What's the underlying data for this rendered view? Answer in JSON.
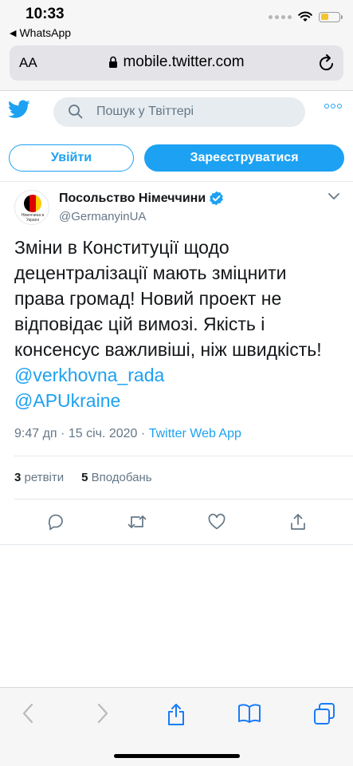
{
  "status_bar": {
    "time": "10:33",
    "back_app": "WhatsApp"
  },
  "browser": {
    "text_size_label": "AA",
    "url": "mobile.twitter.com"
  },
  "header": {
    "search_placeholder": "Пошук у Твіттері"
  },
  "auth": {
    "login_label": "Увійти",
    "signup_label": "Зареєструватися"
  },
  "tweet": {
    "author_name": "Посольство Німеччини",
    "handle": "@GermanyinUA",
    "avatar_caption": "Німеччина в Україні",
    "text": "Зміни в Конституції щодо децентралізації мають зміцнити права громад! Новий проект не відповідає цій вимозі. Якість і консенсус важливіші, ніж швидкість! ",
    "mention_1": "@verkhovna_rada",
    "mention_2": "@APUkraine",
    "time": "9:47 дп",
    "separator": "·",
    "date": "15 січ. 2020",
    "source": "Twitter Web App",
    "retweets_count": "3",
    "retweets_label": "ретвіти",
    "likes_count": "5",
    "likes_label": "Вподобань"
  },
  "colors": {
    "accent": "#1da1f2",
    "text": "#14171a",
    "secondary_text": "#657786"
  },
  "icons": {
    "bird": "twitter-bird-icon",
    "search": "search-icon",
    "more": "more-icon",
    "verified": "verified-badge-icon",
    "chevron": "chevron-down-icon",
    "reply": "reply-icon",
    "retweet": "retweet-icon",
    "like": "like-icon",
    "share": "share-icon"
  }
}
